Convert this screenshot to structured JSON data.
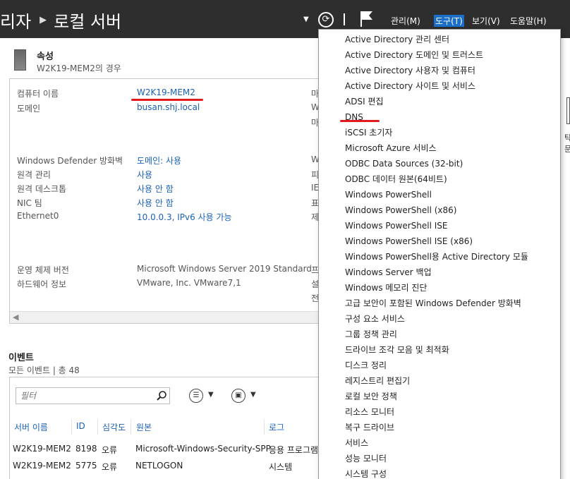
{
  "header": {
    "breadcrumb_prev": "리자",
    "breadcrumb_current": "로컬 서버",
    "menus": [
      {
        "label": "관리(M)"
      },
      {
        "label": "도구(T)"
      },
      {
        "label": "보기(V)"
      },
      {
        "label": "도움말(H)"
      }
    ]
  },
  "properties": {
    "title": "속성",
    "subtitle": "W2K19-MEM2의 경우",
    "rows": [
      {
        "label": "컴퓨터 이름",
        "value": "W2K19-MEM2"
      },
      {
        "label": "도메인",
        "value": "busan.shj.local"
      },
      {
        "label": "Windows Defender 방화벽",
        "value": "도메인: 사용"
      },
      {
        "label": "원격 관리",
        "value": "사용"
      },
      {
        "label": "원격 데스크톱",
        "value": "사용 안 함"
      },
      {
        "label": "NIC 팀",
        "value": "사용 안 함"
      },
      {
        "label": "Ethernet0",
        "value": "10.0.0.3, IPv6 사용 가능"
      },
      {
        "label": "운영 체제 버전",
        "value": "Microsoft Windows Server 2019 Standard"
      },
      {
        "label": "하드웨어 정보",
        "value": "VMware, Inc. VMware7,1"
      }
    ],
    "right_col": [
      "마",
      "W",
      "마",
      "W",
      "피",
      "IE",
      "표",
      "제",
      "프",
      "설",
      "전"
    ]
  },
  "events": {
    "title": "이벤트",
    "subtitle": "모든 이벤트 | 총 48",
    "filter_placeholder": "필터",
    "columns": [
      "서버 이름",
      "ID",
      "심각도",
      "원본",
      "로그"
    ],
    "rows": [
      [
        "W2K19-MEM2",
        "8198",
        "오류",
        "Microsoft-Windows-Security-SPP",
        "응용 프로그램"
      ],
      [
        "W2K19-MEM2",
        "5775",
        "오류",
        "NETLOGON",
        "시스템"
      ]
    ]
  },
  "tools_menu": [
    "Active Directory 관리 센터",
    "Active Directory 도메인 및 트러스트",
    "Active Directory 사용자 및 컴퓨터",
    "Active Directory 사이트 및 서비스",
    "ADSI 편집",
    "DNS",
    "iSCSI 초기자",
    "Microsoft Azure 서비스",
    "ODBC Data Sources (32-bit)",
    "ODBC 데이터 원본(64비트)",
    "Windows PowerShell",
    "Windows PowerShell (x86)",
    "Windows PowerShell ISE",
    "Windows PowerShell ISE (x86)",
    "Windows PowerShell용 Active Directory 모듈",
    "Windows Server 백업",
    "Windows 메모리 진단",
    "고급 보안이 포함된 Windows Defender 방화벽",
    "구성 요소 서비스",
    "그룹 정책 관리",
    "드라이브 조각 모음 및 최적화",
    "디스크 정리",
    "레지스트리 편집기",
    "로컬 보안 정책",
    "리소스 모니터",
    "복구 드라이브",
    "서비스",
    "성능 모니터",
    "시스템 구성"
  ],
  "right_edge": [
    "탁",
    "문"
  ],
  "colors": {
    "topbar": "#2e2e2e",
    "link": "#1a61b5",
    "active_menu": "#1b6fc8",
    "annotation": "#e0191f"
  }
}
